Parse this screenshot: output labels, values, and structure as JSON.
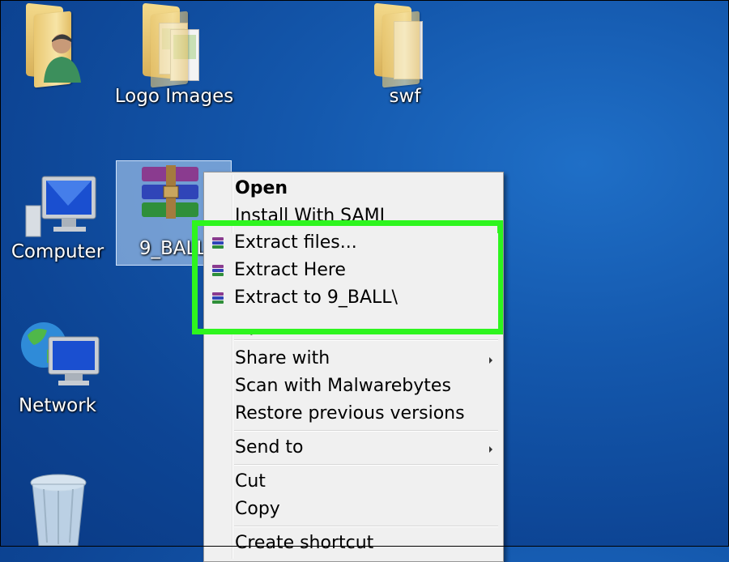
{
  "desktop": {
    "icons": [
      {
        "label": "",
        "icon": "user-folder-icon"
      },
      {
        "label": "Logo Images",
        "icon": "folder-icon"
      },
      {
        "label": "swf",
        "icon": "folder-icon"
      },
      {
        "label": "Computer",
        "icon": "computer-icon"
      },
      {
        "label": "9_BALL",
        "icon": "winrar-archive-icon"
      },
      {
        "label": "Network",
        "icon": "network-icon"
      },
      {
        "label": "",
        "icon": "recycle-bin-icon"
      }
    ]
  },
  "context_menu": {
    "items": [
      {
        "label": "Open",
        "bold": true
      },
      {
        "label": "Install With SAMI"
      },
      {
        "label": "Extract files...",
        "icon": "winrar-icon"
      },
      {
        "label": "Extract Here",
        "icon": "winrar-icon"
      },
      {
        "label": "Extract to 9_BALL\\",
        "icon": "winrar-icon"
      },
      {
        "label": "Open with",
        "submenu": true
      },
      {
        "label": "Share with",
        "submenu": true
      },
      {
        "label": "Scan with Malwarebytes"
      },
      {
        "label": "Restore previous versions"
      },
      {
        "label": "Send to",
        "submenu": true
      },
      {
        "label": "Cut"
      },
      {
        "label": "Copy"
      },
      {
        "label": "Create shortcut"
      }
    ]
  },
  "highlight": {
    "color": "#2ef51e"
  }
}
